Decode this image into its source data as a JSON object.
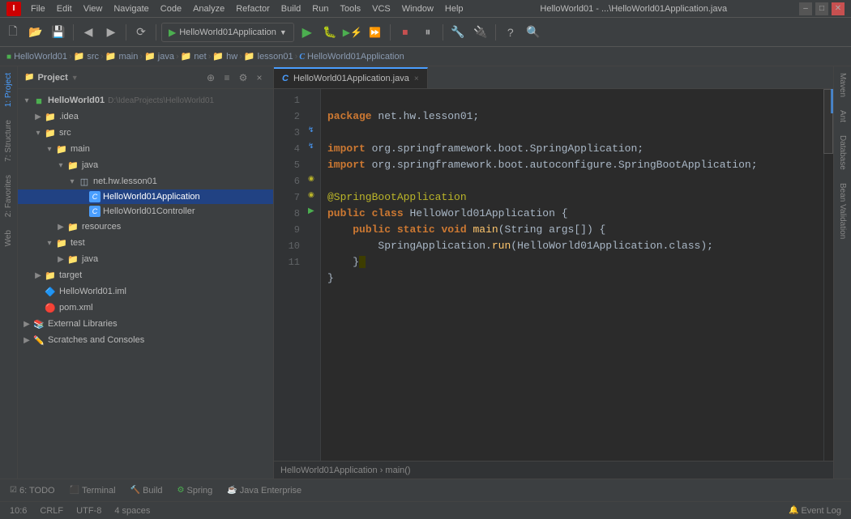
{
  "titleBar": {
    "title": "HelloWorld01 - ...\\HelloWorld01Application.java",
    "menuItems": [
      "File",
      "Edit",
      "View",
      "Navigate",
      "Code",
      "Analyze",
      "Refactor",
      "Build",
      "Run",
      "Tools",
      "VCS",
      "Window",
      "Help"
    ],
    "windowControls": [
      "–",
      "□",
      "✕"
    ]
  },
  "toolbar": {
    "runConfig": "HelloWorld01Application",
    "buttons": [
      "⟳",
      "↩",
      "↪",
      "✓",
      "▶",
      "⚡",
      "↶",
      "↷",
      "⏹",
      "⏸",
      "⏭",
      "🔧",
      "🔌",
      "⬛",
      "🔍"
    ]
  },
  "breadcrumb": {
    "items": [
      "HelloWorld01",
      "src",
      "main",
      "java",
      "net",
      "hw",
      "lesson01",
      "HelloWorld01Application"
    ]
  },
  "sidebar": {
    "leftTabs": [
      "1: Project",
      "7: Structure",
      "2: Favorites",
      "Web"
    ]
  },
  "projectPanel": {
    "title": "Project",
    "tree": [
      {
        "level": 0,
        "label": "HelloWorld01",
        "extra": "D:\\IdeaProjects\\HelloWorld01",
        "icon": "📁",
        "expanded": true,
        "type": "module"
      },
      {
        "level": 1,
        "label": ".idea",
        "icon": "📁",
        "expanded": false,
        "type": "folder"
      },
      {
        "level": 1,
        "label": "src",
        "icon": "📁",
        "expanded": true,
        "type": "folder"
      },
      {
        "level": 2,
        "label": "main",
        "icon": "📁",
        "expanded": true,
        "type": "folder"
      },
      {
        "level": 3,
        "label": "java",
        "icon": "📁",
        "expanded": true,
        "type": "source"
      },
      {
        "level": 4,
        "label": "net.hw.lesson01",
        "icon": "📦",
        "expanded": true,
        "type": "package"
      },
      {
        "level": 5,
        "label": "HelloWorld01Application",
        "icon": "C",
        "expanded": false,
        "type": "class",
        "selected": true
      },
      {
        "level": 5,
        "label": "HelloWorld01Controller",
        "icon": "C",
        "expanded": false,
        "type": "class"
      },
      {
        "level": 3,
        "label": "resources",
        "icon": "📁",
        "expanded": false,
        "type": "folder"
      },
      {
        "level": 2,
        "label": "test",
        "icon": "📁",
        "expanded": true,
        "type": "folder"
      },
      {
        "level": 3,
        "label": "java",
        "icon": "📁",
        "expanded": false,
        "type": "source"
      },
      {
        "level": 1,
        "label": "target",
        "icon": "📁",
        "expanded": false,
        "type": "folder"
      },
      {
        "level": 1,
        "label": "HelloWorld01.iml",
        "icon": "🔷",
        "type": "file"
      },
      {
        "level": 1,
        "label": "pom.xml",
        "icon": "🔴",
        "type": "file"
      },
      {
        "level": 0,
        "label": "External Libraries",
        "icon": "📚",
        "expanded": false,
        "type": "library"
      },
      {
        "level": 0,
        "label": "Scratches and Consoles",
        "icon": "✏️",
        "expanded": false,
        "type": "scratches"
      }
    ]
  },
  "editor": {
    "tabs": [
      {
        "label": "HelloWorld01Application.java",
        "active": true,
        "icon": "C"
      }
    ],
    "filename": "HelloWorld01Application.java",
    "breadcrumb": "HelloWorld01Application › main()",
    "lines": [
      {
        "num": 1,
        "code": "package net.hw.lesson01;"
      },
      {
        "num": 2,
        "code": ""
      },
      {
        "num": 3,
        "code": "import org.springframework.boot.SpringApplication;"
      },
      {
        "num": 4,
        "code": "import org.springframework.boot.autoconfigure.SpringBootApplication;"
      },
      {
        "num": 5,
        "code": ""
      },
      {
        "num": 6,
        "code": "@SpringBootApplication"
      },
      {
        "num": 7,
        "code": "public class HelloWorld01Application {"
      },
      {
        "num": 8,
        "code": "    public static void main(String args[]) {"
      },
      {
        "num": 9,
        "code": "        SpringApplication.run(HelloWorld01Application.class);"
      },
      {
        "num": 10,
        "code": "    }"
      },
      {
        "num": 11,
        "code": "}"
      }
    ]
  },
  "rightSidebar": {
    "tabs": [
      "Maven",
      "Ant",
      "Database",
      "Bean Validation"
    ]
  },
  "statusBar": {
    "items": [
      "6: TODO",
      "Terminal",
      "Build",
      "Spring",
      "Java Enterprise"
    ],
    "right": [
      "10:6",
      "CRLF",
      "UTF-8",
      "4 spaces",
      "Event Log"
    ]
  }
}
